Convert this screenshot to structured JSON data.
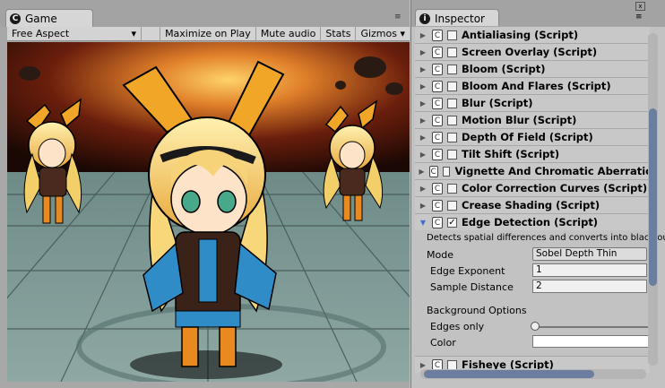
{
  "game": {
    "tab_label": "Game",
    "menu_glyph": "≡",
    "toolbar": {
      "aspect": "Free Aspect",
      "dropdown_glyph": "▾",
      "maximize": "Maximize on Play",
      "mute": "Mute audio",
      "stats": "Stats",
      "gizmos": "Gizmos",
      "gizmos_glyph": "▾"
    }
  },
  "inspector": {
    "tab_label": "Inspector",
    "tab_icon": "info-icon",
    "components": [
      {
        "label": "Antialiasing (Script)",
        "checked": false,
        "expanded": false
      },
      {
        "label": "Screen Overlay (Script)",
        "checked": false,
        "expanded": false
      },
      {
        "label": "Bloom (Script)",
        "checked": false,
        "expanded": false
      },
      {
        "label": "Bloom And Flares (Script)",
        "checked": false,
        "expanded": false
      },
      {
        "label": "Blur (Script)",
        "checked": false,
        "expanded": false
      },
      {
        "label": "Motion Blur (Script)",
        "checked": false,
        "expanded": false
      },
      {
        "label": "Depth Of Field (Script)",
        "checked": false,
        "expanded": false
      },
      {
        "label": "Tilt Shift (Script)",
        "checked": false,
        "expanded": false
      },
      {
        "label": "Vignette And Chromatic Aberration (Script)",
        "checked": false,
        "expanded": false
      },
      {
        "label": "Color Correction Curves (Script)",
        "checked": false,
        "expanded": false
      },
      {
        "label": "Crease Shading (Script)",
        "checked": false,
        "expanded": false
      },
      {
        "label": "Edge Detection (Script)",
        "checked": true,
        "expanded": true
      }
    ],
    "edge_detection": {
      "description": "Detects spatial differences and converts into black outlines",
      "mode_label": "Mode",
      "mode_value": "Sobel Depth Thin",
      "edge_exponent_label": "Edge Exponent",
      "edge_exponent_value": "1",
      "sample_distance_label": "Sample Distance",
      "sample_distance_value": "2",
      "background_options_label": "Background Options",
      "edges_only_label": "Edges only",
      "edges_only_value": 0,
      "color_label": "Color",
      "color_value": "#ffffff"
    },
    "last_component": {
      "label": "Fisheye (Script)",
      "checked": false,
      "expanded": false
    }
  },
  "colors": {
    "accent_blue": "#3f6ecf",
    "scrollbar_thumb": "#6c7ea0"
  }
}
